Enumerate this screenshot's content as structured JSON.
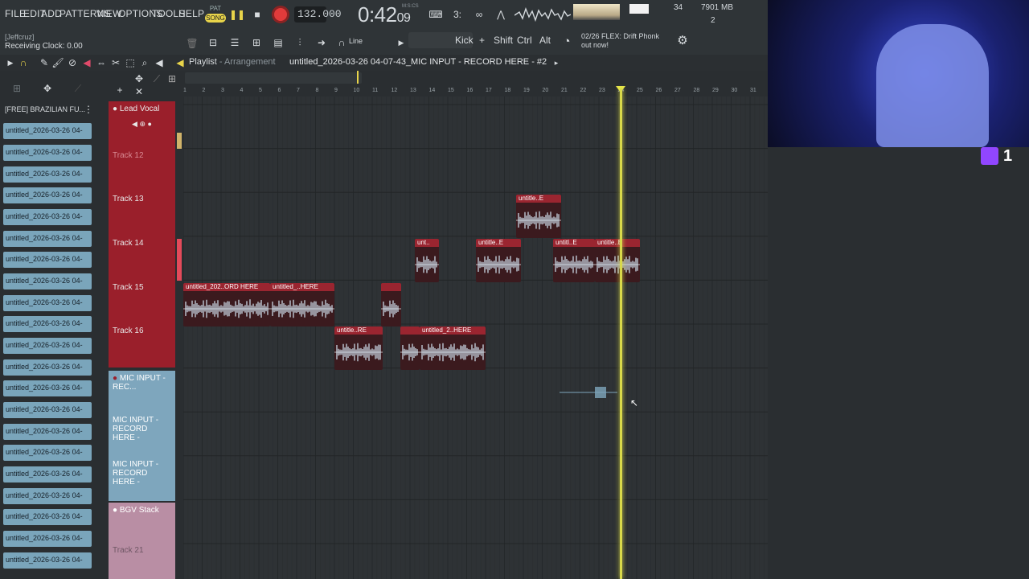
{
  "menu": [
    "FILE",
    "EDIT",
    "ADD",
    "PATTERNS",
    "VIEW",
    "OPTIONS",
    "TOOLS",
    "HELP"
  ],
  "pat_song": {
    "pat": "PAT",
    "song": "SONG"
  },
  "tempo": "132.000",
  "clock": "0:42",
  "clock_ms": "09",
  "clock_unit": "M:S:CS",
  "cpu": "34",
  "memory": "7901 MB",
  "polyphony": "2",
  "user": "[Jeffcruz]",
  "receiving_clock": "Receiving Clock: 0.00",
  "snap": "Line",
  "kick": "Kick",
  "modifiers": [
    "Shift",
    "Ctrl",
    "Alt"
  ],
  "news": {
    "line1": "02/26  FLEX: Drift Phonk",
    "line2": "out now!"
  },
  "playlist": {
    "title": "Playlist",
    "sub": "- Arrangement",
    "pattern": "untitled_2026-03-26 04-07-43_MIC INPUT - RECORD HERE - #2"
  },
  "picker": {
    "header": "[FREE] BRAZILIAN FU...",
    "items": [
      "untitled_2026-03-26 04-",
      "untitled_2026-03-26 04-",
      "untitled_2026-03-26 04-",
      "untitled_2026-03-26 04-",
      "untitled_2026-03-26 04-",
      "untitled_2026-03-26 04-",
      "untitled_2026-03-26 04-",
      "untitled_2026-03-26 04-",
      "untitled_2026-03-26 04-",
      "untitled_2026-03-26 04-",
      "untitled_2026-03-26 04-",
      "untitled_2026-03-26 04-",
      "untitled_2026-03-26 04-",
      "untitled_2026-03-26 04-",
      "untitled_2026-03-26 04-",
      "untitled_2026-03-26 04-",
      "untitled_2026-03-26 04-",
      "untitled_2026-03-26 04-",
      "untitled_2026-03-26 04-",
      "untitled_2026-03-26 04-",
      "untitled_2026-03-26 04-"
    ]
  },
  "tracks": {
    "lead_vocal": "Lead Vocal",
    "t12": "Track 12",
    "t13": "Track 13",
    "t14": "Track 14",
    "t15": "Track 15",
    "t16": "Track 16",
    "mic_input": "MIC INPUT - REC...",
    "mic2": "MIC INPUT - RECORD HERE -",
    "mic3": "MIC INPUT - RECORD HERE -",
    "bgv": "BGV Stack",
    "t21": "Track 21"
  },
  "ruler": [
    "1",
    "2",
    "3",
    "4",
    "5",
    "6",
    "7",
    "8",
    "9",
    "10",
    "11",
    "12",
    "13",
    "14",
    "15",
    "16",
    "17",
    "18",
    "19",
    "20",
    "21",
    "22",
    "23",
    "24",
    "25",
    "26",
    "27",
    "28",
    "29",
    "30",
    "31"
  ],
  "clips": {
    "c1": "untitle..E",
    "c2": "unt..",
    "c3": "untitle..E",
    "c4": "untitl..E",
    "c5": "untitle..E",
    "c6": "untitled_202..ORD HERE",
    "c7": "untitled_..HERE",
    "c8": "",
    "c9": "untitle..RE",
    "c10": "",
    "c11": "untitled_2..HERE"
  },
  "twitch_count": "1",
  "colors": {
    "vocal": "#9a1f2b",
    "mic": "#7ea6bd",
    "bgv": "#b98ea4",
    "playhead": "#d8d84a",
    "twitch": "#9146ff"
  }
}
